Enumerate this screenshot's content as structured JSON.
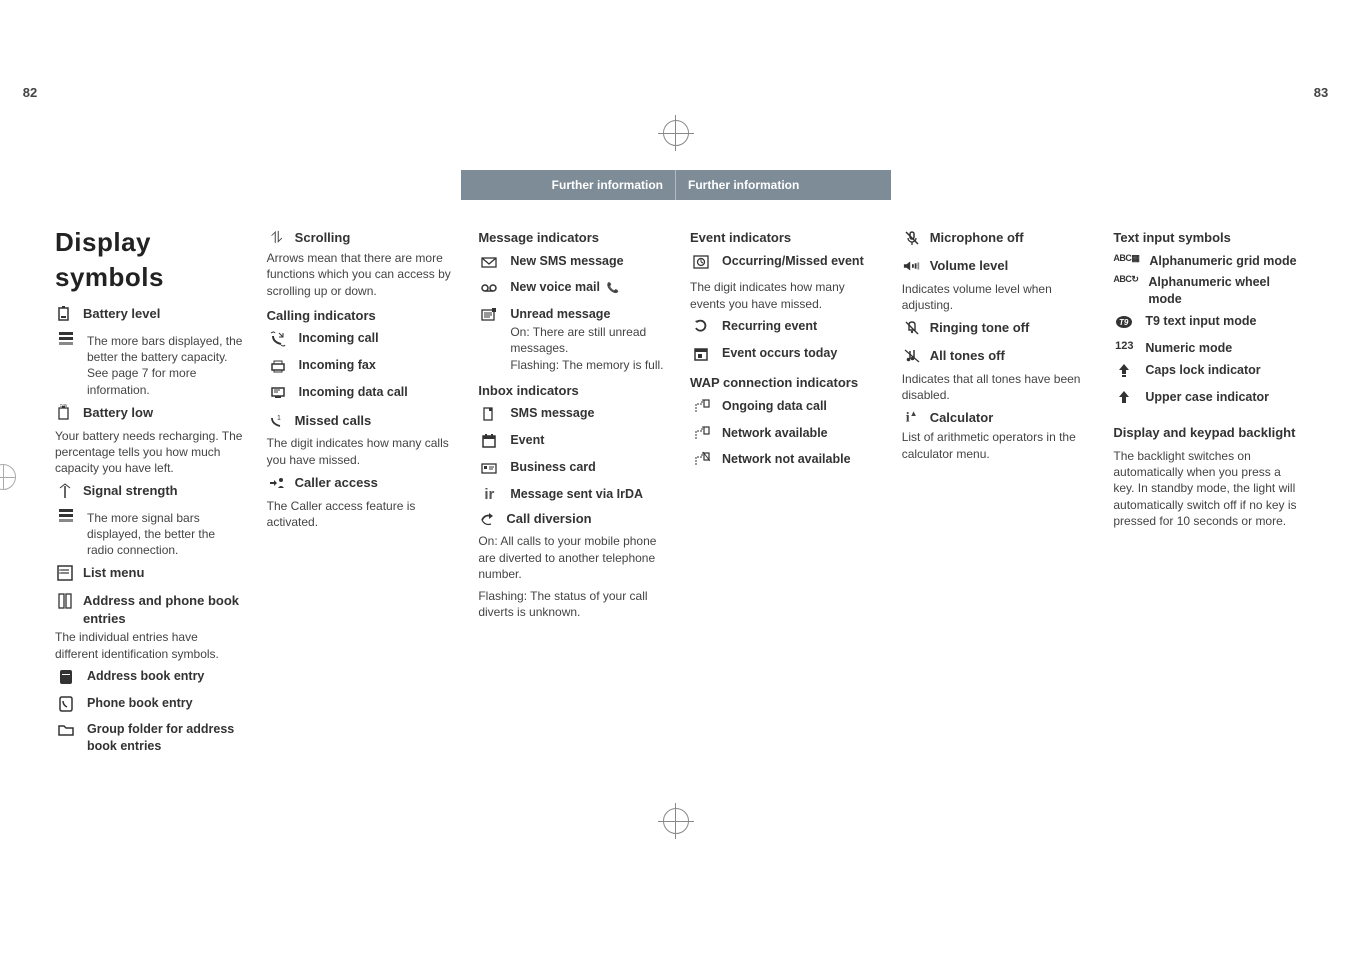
{
  "page_left_num": "82",
  "page_right_num": "83",
  "ribbon_text": "Further information",
  "title": "Display symbols",
  "col1": {
    "battery_level": "Battery level",
    "battery_level_desc": "The more bars displayed, the better the battery capacity. See page 7 for more information.",
    "battery_low": "Battery low",
    "battery_low_desc": "Your battery needs recharging. The percentage tells you how much capacity you have left.",
    "signal": "Signal strength",
    "signal_desc": "The more signal bars displayed, the better the radio connection.",
    "list_menu": "List menu",
    "address": "Address and phone book entries",
    "address_desc": "The individual entries have different identification symbols.",
    "addr_entry": "Address book entry",
    "phone_entry": "Phone book entry",
    "group_entry": "Group folder for address book entries"
  },
  "col2": {
    "scrolling": "Scrolling",
    "scrolling_desc": "Arrows mean that there are more functions which you can access by scrolling up or down.",
    "calling": "Calling indicators",
    "incoming_call": "Incoming call",
    "incoming_fax": "Incoming fax",
    "incoming_data": "Incoming data call",
    "missed": "Missed calls",
    "missed_desc": "The digit indicates how many calls you have missed.",
    "caller_access": "Caller access",
    "caller_access_desc": "The Caller access feature is activated."
  },
  "col3": {
    "msg_ind": "Message indicators",
    "new_sms": "New SMS message",
    "new_vm": "New voice mail",
    "unread": "Unread message",
    "unread_on": "On: There are still unread messages.",
    "unread_flash": "Flashing: The memory is full.",
    "inbox": "Inbox indicators",
    "sms_msg": "SMS message",
    "event": "Event",
    "bcard": "Business card",
    "irda": "Message sent via IrDA",
    "call_div": "Call diversion",
    "call_div_on": "On: All calls to your mobile phone are diverted to another telephone number.",
    "call_div_flash": "Flashing: The status of your call diverts is unknown."
  },
  "col4": {
    "event_ind": "Event indicators",
    "occ_missed": "Occurring/Missed event",
    "occ_missed_desc": "The digit indicates how many events you have missed.",
    "recurring": "Recurring event",
    "today": "Event occurs today",
    "wap": "WAP connection indicators",
    "ongoing": "Ongoing data call",
    "net_avail": "Network available",
    "net_not": "Network not available"
  },
  "col5": {
    "mic_off": "Microphone off",
    "vol": "Volume level",
    "vol_desc": "Indicates volume level when adjusting.",
    "ring_off": "Ringing tone off",
    "all_off": "All tones off",
    "all_off_desc": "Indicates that all tones have been disabled.",
    "calc": "Calculator",
    "calc_desc": "List of arithmetic operators in the calculator menu."
  },
  "col6": {
    "text_sym": "Text input symbols",
    "alnum_grid": "Alphanumeric grid mode",
    "alnum_wheel": "Alphanumeric wheel mode",
    "t9": "T9 text input mode",
    "numeric": "Numeric mode",
    "caps": "Caps lock indicator",
    "upper": "Upper case indicator",
    "backlight": "Display and keypad backlight",
    "backlight_desc": "The backlight switches on automatically when you press a key. In standby mode, the light will automatically switch off if no key is pressed for 10 seconds or more."
  }
}
